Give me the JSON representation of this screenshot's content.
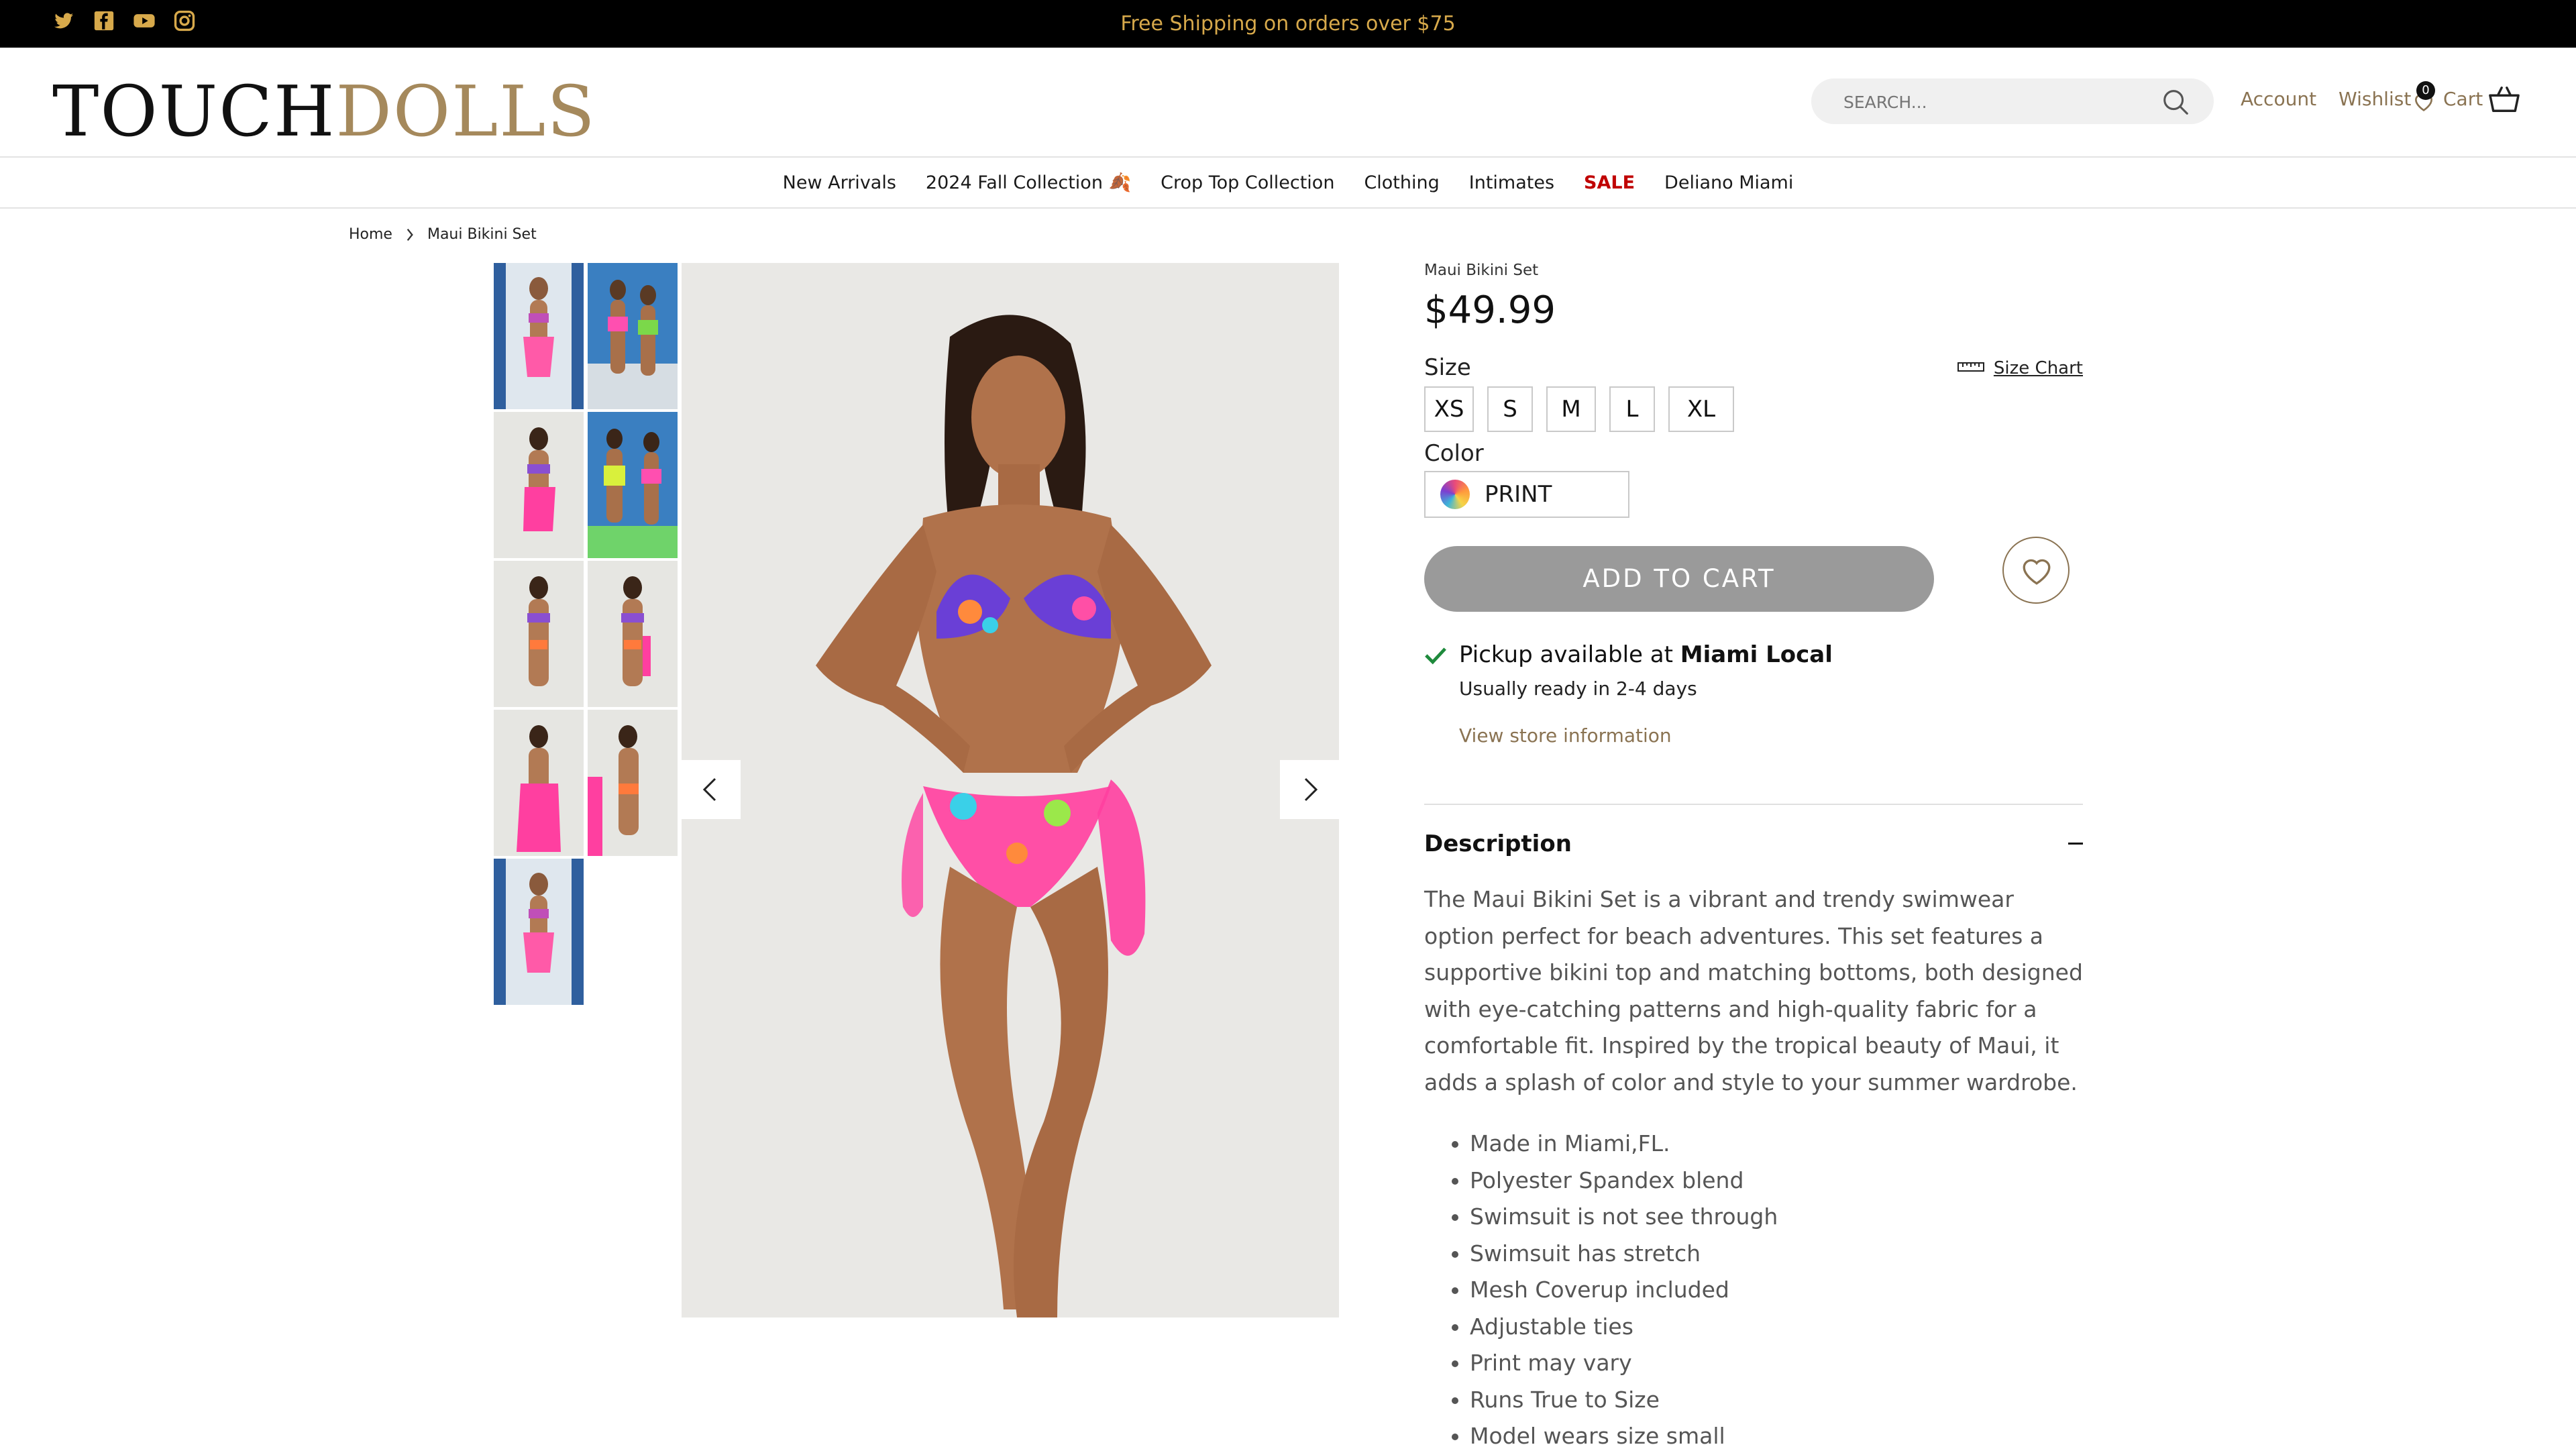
{
  "announcement": {
    "text": "Free Shipping on orders over $75"
  },
  "social": [
    "twitter-icon",
    "facebook-icon",
    "youtube-icon",
    "instagram-icon"
  ],
  "logo": {
    "part1": "TOUCH",
    "part2": "DOLLS"
  },
  "search": {
    "placeholder": "SEARCH..."
  },
  "header": {
    "account": "Account",
    "wishlist": "Wishlist",
    "wishlist_count": "0",
    "cart": "Cart"
  },
  "nav": {
    "items": [
      "New Arrivals",
      "2024 Fall Collection 🍂",
      "Crop Top Collection",
      "Clothing",
      "Intimates",
      "SALE",
      "Deliano Miami"
    ]
  },
  "breadcrumb": {
    "home": "Home",
    "current": "Maui Bikini Set"
  },
  "product": {
    "name": "Maui Bikini Set",
    "price": "$49.99",
    "size_label": "Size",
    "size_chart": "Size Chart",
    "sizes": [
      "XS",
      "S",
      "M",
      "L",
      "XL"
    ],
    "color_label": "Color",
    "color_value": "PRINT",
    "add_to_cart": "ADD TO CART",
    "pickup_text": "Pickup available at ",
    "pickup_location": "Miami Local",
    "pickup_sub": "Usually ready in 2-4 days",
    "store_link": "View store information",
    "description_heading": "Description",
    "description": "The Maui Bikini Set is a vibrant and trendy swimwear option perfect for beach adventures. This set features a supportive bikini top and matching bottoms, both designed with eye-catching patterns and high-quality fabric for a comfortable fit. Inspired by the tropical beauty of Maui, it adds a splash of color and style to your summer wardrobe.",
    "bullets": [
      "Made in Miami,FL.",
      "Polyester Spandex blend",
      "Swimsuit is not see through",
      "Swimsuit has stretch",
      "Mesh Coverup included",
      "Adjustable ties",
      "Print may vary",
      "Runs True to Size",
      "Model wears size small"
    ]
  },
  "colors": {
    "accent": "#8a7352",
    "announce_text": "#d7a94b",
    "sale": "#c00000",
    "button_disabled": "#9a9a9a"
  }
}
